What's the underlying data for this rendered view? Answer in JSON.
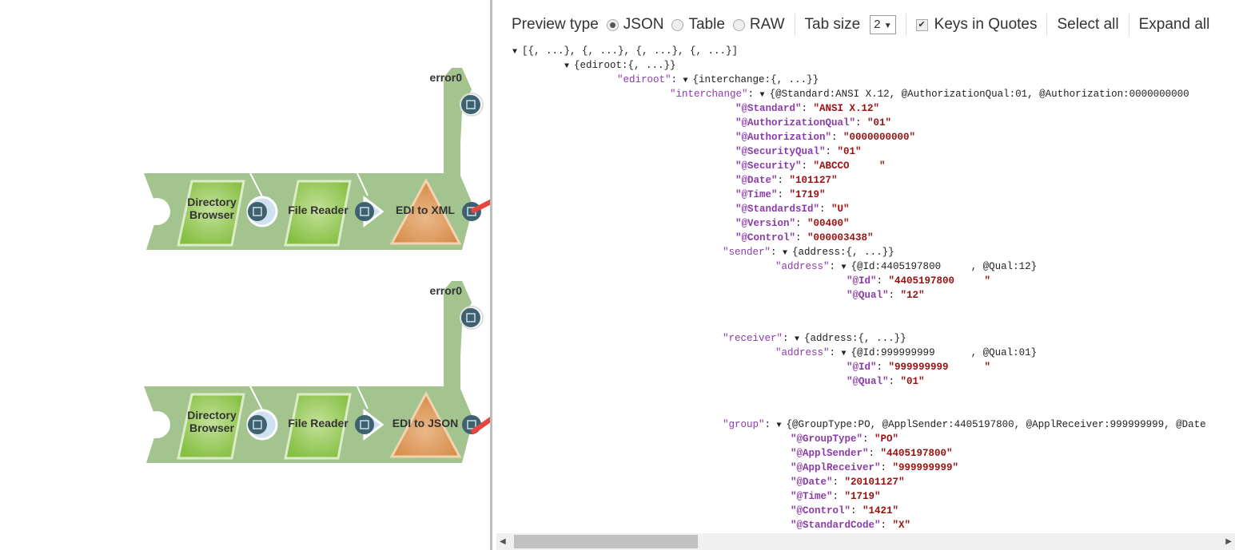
{
  "pipelines": [
    {
      "error_label": "error0",
      "snaps": [
        "Directory Browser",
        "File Reader",
        "EDI to XML"
      ],
      "snap_lines": [
        [
          "Directory",
          "Browser"
        ],
        [
          "File Reader"
        ],
        [
          "EDI to XML"
        ]
      ]
    },
    {
      "error_label": "error0",
      "snaps": [
        "Directory Browser",
        "File Reader",
        "EDI to JSON"
      ],
      "snap_lines": [
        [
          "Directory",
          "Browser"
        ],
        [
          "File Reader"
        ],
        [
          "EDI to JSON"
        ]
      ]
    }
  ],
  "toolbar": {
    "preview_type_label": "Preview type",
    "options": [
      "JSON",
      "Table",
      "RAW"
    ],
    "selected": "JSON",
    "tab_size_label": "Tab size",
    "tab_size": "2",
    "keys_in_quotes_label": "Keys in Quotes",
    "keys_in_quotes": true,
    "select_all": "Select all",
    "expand_all": "Expand all"
  },
  "tree": {
    "root_summary": "[{, ...}, {, ...}, {, ...}, {, ...}]",
    "item_summary": "{ediroot:{, ...}}",
    "ediroot": {
      "key": "\"ediroot\"",
      "summary": "{interchange:{, ...}}"
    },
    "interchange": {
      "key": "\"interchange\"",
      "summary": "{@Standard:ANSI X.12, @AuthorizationQual:01, @Authorization:0000000000",
      "fields": [
        {
          "k": "\"@Standard\"",
          "v": "\"ANSI X.12\""
        },
        {
          "k": "\"@AuthorizationQual\"",
          "v": "\"01\""
        },
        {
          "k": "\"@Authorization\"",
          "v": "\"0000000000\""
        },
        {
          "k": "\"@SecurityQual\"",
          "v": "\"01\""
        },
        {
          "k": "\"@Security\"",
          "v": "\"ABCCO     \""
        },
        {
          "k": "\"@Date\"",
          "v": "\"101127\""
        },
        {
          "k": "\"@Time\"",
          "v": "\"1719\""
        },
        {
          "k": "\"@StandardsId\"",
          "v": "\"U\""
        },
        {
          "k": "\"@Version\"",
          "v": "\"00400\""
        },
        {
          "k": "\"@Control\"",
          "v": "\"000003438\""
        }
      ]
    },
    "sender": {
      "key": "\"sender\"",
      "summary": "{address:{, ...}}",
      "address_key": "\"address\"",
      "address_summary": "{@Id:4405197800     , @Qual:12}",
      "fields": [
        {
          "k": "\"@Id\"",
          "v": "\"4405197800     \""
        },
        {
          "k": "\"@Qual\"",
          "v": "\"12\""
        }
      ]
    },
    "receiver": {
      "key": "\"receiver\"",
      "summary": "{address:{, ...}}",
      "address_key": "\"address\"",
      "address_summary": "{@Id:999999999      , @Qual:01}",
      "fields": [
        {
          "k": "\"@Id\"",
          "v": "\"999999999      \""
        },
        {
          "k": "\"@Qual\"",
          "v": "\"01\""
        }
      ]
    },
    "group": {
      "key": "\"group\"",
      "summary": "{@GroupType:PO, @ApplSender:4405197800, @ApplReceiver:999999999, @Date",
      "fields": [
        {
          "k": "\"@GroupType\"",
          "v": "\"PO\""
        },
        {
          "k": "\"@ApplSender\"",
          "v": "\"4405197800\""
        },
        {
          "k": "\"@ApplReceiver\"",
          "v": "\"999999999\""
        },
        {
          "k": "\"@Date\"",
          "v": "\"20101127\""
        },
        {
          "k": "\"@Time\"",
          "v": "\"1719\""
        },
        {
          "k": "\"@Control\"",
          "v": "\"1421\""
        },
        {
          "k": "\"@StandardCode\"",
          "v": "\"X\""
        }
      ]
    }
  },
  "colors": {
    "band": "#a3c48f",
    "snap_green": "#8dc44d",
    "snap_orange": "#dc9456",
    "port": "#3d6170",
    "arrow": "#e8453c",
    "key": "#8b3ba8",
    "value": "#9a1010"
  }
}
